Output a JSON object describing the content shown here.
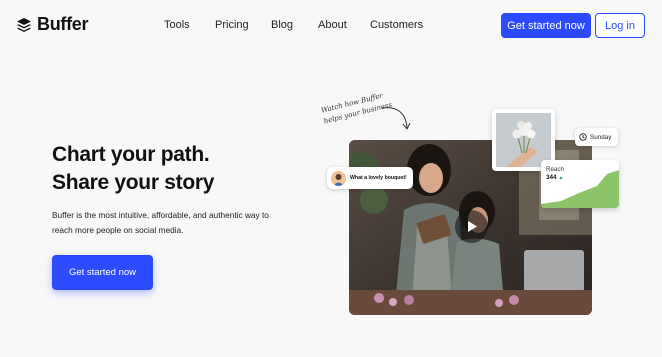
{
  "brand": {
    "name": "Buffer",
    "accent": "#2c4bff"
  },
  "nav": {
    "items": [
      {
        "label": "Tools"
      },
      {
        "label": "Pricing"
      },
      {
        "label": "Blog"
      },
      {
        "label": "About"
      },
      {
        "label": "Customers"
      }
    ],
    "cta_label": "Get started now",
    "login_label": "Log in"
  },
  "hero": {
    "title_line1": "Chart your path.",
    "title_line2": "Share your story",
    "subtitle": "Buffer is the most intuitive, affordable, and authentic way to reach more people on social media.",
    "cta_label": "Get started now"
  },
  "visual": {
    "handwritten_line1": "Watch how Buffer",
    "handwritten_line2": "helps your business",
    "comment_text": "What a lovely bouquet!",
    "schedule_day": "Sunday",
    "reach_label": "Reach",
    "reach_value": "344",
    "reach_color": "#8cc46a",
    "icons": [
      "buffer-logo-icon",
      "play-icon",
      "clock-icon",
      "trend-up-icon"
    ]
  }
}
